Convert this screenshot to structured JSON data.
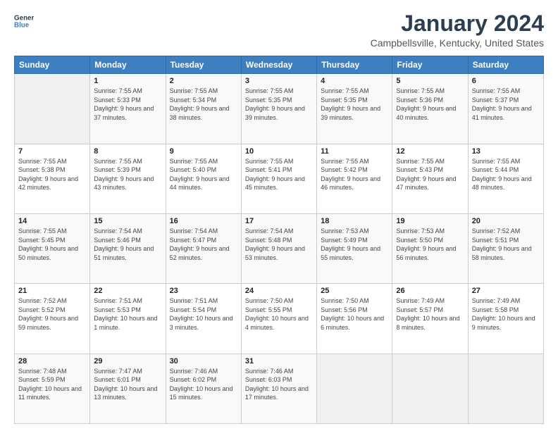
{
  "logo": {
    "text_general": "General",
    "text_blue": "Blue"
  },
  "header": {
    "month_title": "January 2024",
    "location": "Campbellsville, Kentucky, United States"
  },
  "columns": [
    "Sunday",
    "Monday",
    "Tuesday",
    "Wednesday",
    "Thursday",
    "Friday",
    "Saturday"
  ],
  "weeks": [
    [
      {
        "day": "",
        "sunrise": "",
        "sunset": "",
        "daylight": ""
      },
      {
        "day": "1",
        "sunrise": "Sunrise: 7:55 AM",
        "sunset": "Sunset: 5:33 PM",
        "daylight": "Daylight: 9 hours and 37 minutes."
      },
      {
        "day": "2",
        "sunrise": "Sunrise: 7:55 AM",
        "sunset": "Sunset: 5:34 PM",
        "daylight": "Daylight: 9 hours and 38 minutes."
      },
      {
        "day": "3",
        "sunrise": "Sunrise: 7:55 AM",
        "sunset": "Sunset: 5:35 PM",
        "daylight": "Daylight: 9 hours and 39 minutes."
      },
      {
        "day": "4",
        "sunrise": "Sunrise: 7:55 AM",
        "sunset": "Sunset: 5:35 PM",
        "daylight": "Daylight: 9 hours and 39 minutes."
      },
      {
        "day": "5",
        "sunrise": "Sunrise: 7:55 AM",
        "sunset": "Sunset: 5:36 PM",
        "daylight": "Daylight: 9 hours and 40 minutes."
      },
      {
        "day": "6",
        "sunrise": "Sunrise: 7:55 AM",
        "sunset": "Sunset: 5:37 PM",
        "daylight": "Daylight: 9 hours and 41 minutes."
      }
    ],
    [
      {
        "day": "7",
        "sunrise": "Sunrise: 7:55 AM",
        "sunset": "Sunset: 5:38 PM",
        "daylight": "Daylight: 9 hours and 42 minutes."
      },
      {
        "day": "8",
        "sunrise": "Sunrise: 7:55 AM",
        "sunset": "Sunset: 5:39 PM",
        "daylight": "Daylight: 9 hours and 43 minutes."
      },
      {
        "day": "9",
        "sunrise": "Sunrise: 7:55 AM",
        "sunset": "Sunset: 5:40 PM",
        "daylight": "Daylight: 9 hours and 44 minutes."
      },
      {
        "day": "10",
        "sunrise": "Sunrise: 7:55 AM",
        "sunset": "Sunset: 5:41 PM",
        "daylight": "Daylight: 9 hours and 45 minutes."
      },
      {
        "day": "11",
        "sunrise": "Sunrise: 7:55 AM",
        "sunset": "Sunset: 5:42 PM",
        "daylight": "Daylight: 9 hours and 46 minutes."
      },
      {
        "day": "12",
        "sunrise": "Sunrise: 7:55 AM",
        "sunset": "Sunset: 5:43 PM",
        "daylight": "Daylight: 9 hours and 47 minutes."
      },
      {
        "day": "13",
        "sunrise": "Sunrise: 7:55 AM",
        "sunset": "Sunset: 5:44 PM",
        "daylight": "Daylight: 9 hours and 48 minutes."
      }
    ],
    [
      {
        "day": "14",
        "sunrise": "Sunrise: 7:55 AM",
        "sunset": "Sunset: 5:45 PM",
        "daylight": "Daylight: 9 hours and 50 minutes."
      },
      {
        "day": "15",
        "sunrise": "Sunrise: 7:54 AM",
        "sunset": "Sunset: 5:46 PM",
        "daylight": "Daylight: 9 hours and 51 minutes."
      },
      {
        "day": "16",
        "sunrise": "Sunrise: 7:54 AM",
        "sunset": "Sunset: 5:47 PM",
        "daylight": "Daylight: 9 hours and 52 minutes."
      },
      {
        "day": "17",
        "sunrise": "Sunrise: 7:54 AM",
        "sunset": "Sunset: 5:48 PM",
        "daylight": "Daylight: 9 hours and 53 minutes."
      },
      {
        "day": "18",
        "sunrise": "Sunrise: 7:53 AM",
        "sunset": "Sunset: 5:49 PM",
        "daylight": "Daylight: 9 hours and 55 minutes."
      },
      {
        "day": "19",
        "sunrise": "Sunrise: 7:53 AM",
        "sunset": "Sunset: 5:50 PM",
        "daylight": "Daylight: 9 hours and 56 minutes."
      },
      {
        "day": "20",
        "sunrise": "Sunrise: 7:52 AM",
        "sunset": "Sunset: 5:51 PM",
        "daylight": "Daylight: 9 hours and 58 minutes."
      }
    ],
    [
      {
        "day": "21",
        "sunrise": "Sunrise: 7:52 AM",
        "sunset": "Sunset: 5:52 PM",
        "daylight": "Daylight: 9 hours and 59 minutes."
      },
      {
        "day": "22",
        "sunrise": "Sunrise: 7:51 AM",
        "sunset": "Sunset: 5:53 PM",
        "daylight": "Daylight: 10 hours and 1 minute."
      },
      {
        "day": "23",
        "sunrise": "Sunrise: 7:51 AM",
        "sunset": "Sunset: 5:54 PM",
        "daylight": "Daylight: 10 hours and 3 minutes."
      },
      {
        "day": "24",
        "sunrise": "Sunrise: 7:50 AM",
        "sunset": "Sunset: 5:55 PM",
        "daylight": "Daylight: 10 hours and 4 minutes."
      },
      {
        "day": "25",
        "sunrise": "Sunrise: 7:50 AM",
        "sunset": "Sunset: 5:56 PM",
        "daylight": "Daylight: 10 hours and 6 minutes."
      },
      {
        "day": "26",
        "sunrise": "Sunrise: 7:49 AM",
        "sunset": "Sunset: 5:57 PM",
        "daylight": "Daylight: 10 hours and 8 minutes."
      },
      {
        "day": "27",
        "sunrise": "Sunrise: 7:49 AM",
        "sunset": "Sunset: 5:58 PM",
        "daylight": "Daylight: 10 hours and 9 minutes."
      }
    ],
    [
      {
        "day": "28",
        "sunrise": "Sunrise: 7:48 AM",
        "sunset": "Sunset: 5:59 PM",
        "daylight": "Daylight: 10 hours and 11 minutes."
      },
      {
        "day": "29",
        "sunrise": "Sunrise: 7:47 AM",
        "sunset": "Sunset: 6:01 PM",
        "daylight": "Daylight: 10 hours and 13 minutes."
      },
      {
        "day": "30",
        "sunrise": "Sunrise: 7:46 AM",
        "sunset": "Sunset: 6:02 PM",
        "daylight": "Daylight: 10 hours and 15 minutes."
      },
      {
        "day": "31",
        "sunrise": "Sunrise: 7:46 AM",
        "sunset": "Sunset: 6:03 PM",
        "daylight": "Daylight: 10 hours and 17 minutes."
      },
      {
        "day": "",
        "sunrise": "",
        "sunset": "",
        "daylight": ""
      },
      {
        "day": "",
        "sunrise": "",
        "sunset": "",
        "daylight": ""
      },
      {
        "day": "",
        "sunrise": "",
        "sunset": "",
        "daylight": ""
      }
    ]
  ]
}
